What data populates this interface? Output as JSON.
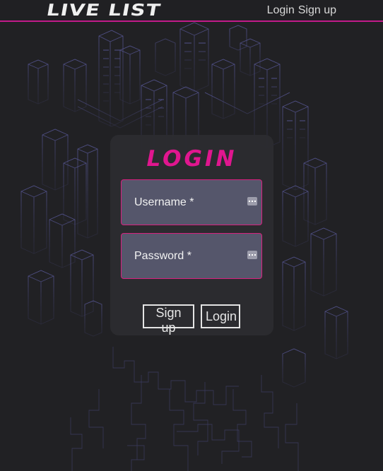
{
  "header": {
    "logo": "LIVE LIST",
    "nav": {
      "login": "Login",
      "signup": "Sign up"
    }
  },
  "colors": {
    "accent": "#e0168f",
    "background": "#212124",
    "card": "#2c2c30",
    "field": "#55566b"
  },
  "login_form": {
    "title": "LOGIN",
    "username": {
      "label": "Username *",
      "value": "",
      "icon": "password-manager-icon"
    },
    "password": {
      "label": "Password *",
      "value": "",
      "icon": "password-manager-icon"
    },
    "buttons": {
      "signup": "Sign up",
      "login": "Login"
    }
  }
}
